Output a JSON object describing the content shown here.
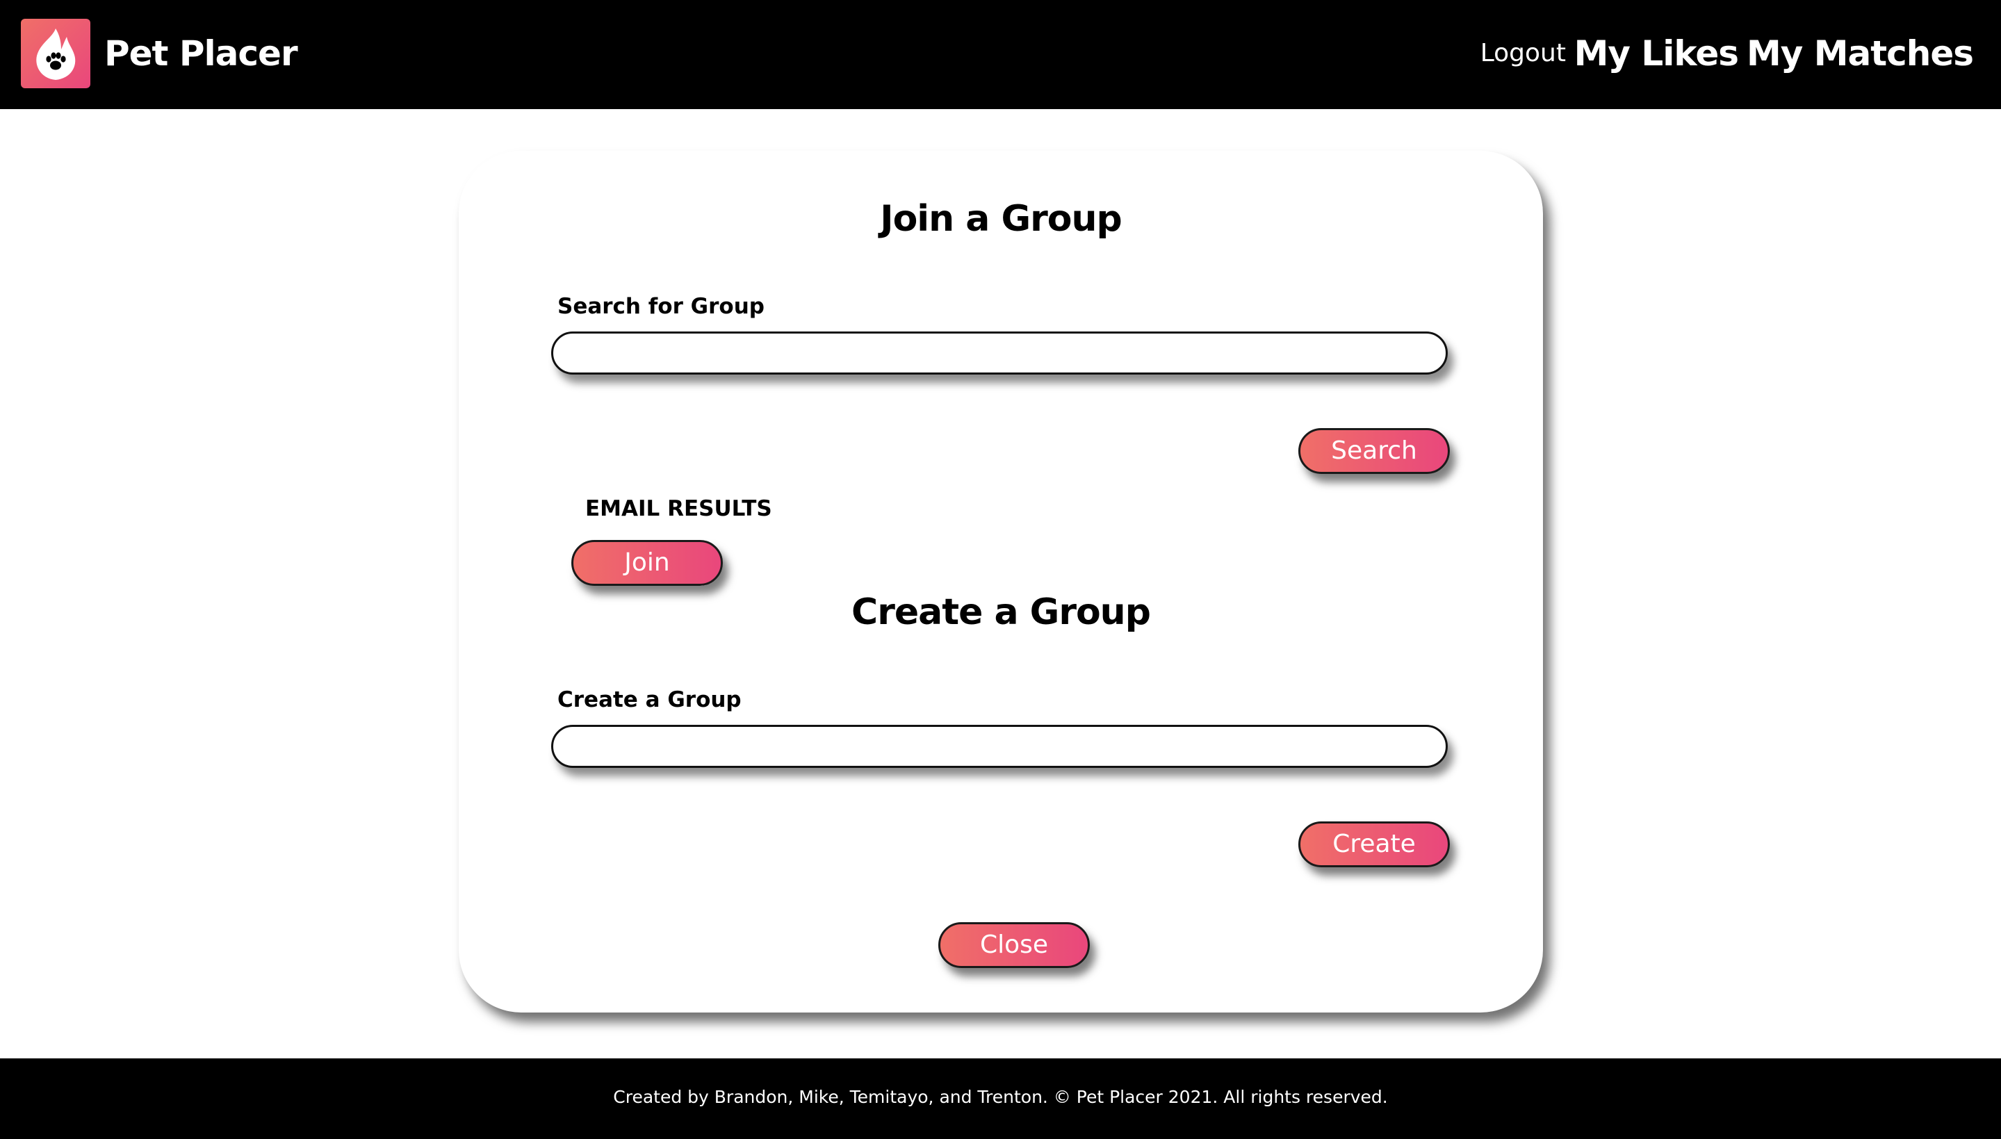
{
  "header": {
    "brand": "Pet Placer",
    "logo_icon": "flame-paw-icon",
    "nav": {
      "logout": "Logout",
      "my_likes": "My Likes",
      "my_matches": "My Matches"
    }
  },
  "join_section": {
    "title": "Join a Group",
    "search_label": "Search for Group",
    "search_value": "",
    "search_button": "Search",
    "results_label": "EMAIL RESULTS",
    "join_button": "Join"
  },
  "create_section": {
    "title": "Create a Group",
    "create_label": "Create a Group",
    "create_value": "",
    "create_button": "Create"
  },
  "close_button": "Close",
  "footer": {
    "text": "Created by Brandon, Mike, Temitayo, and Trenton. © Pet Placer 2021. All rights reserved."
  },
  "colors": {
    "gradient_start": "#f06f68",
    "gradient_end": "#e9477c",
    "bar_background": "#000000",
    "page_background": "#ffffff"
  }
}
